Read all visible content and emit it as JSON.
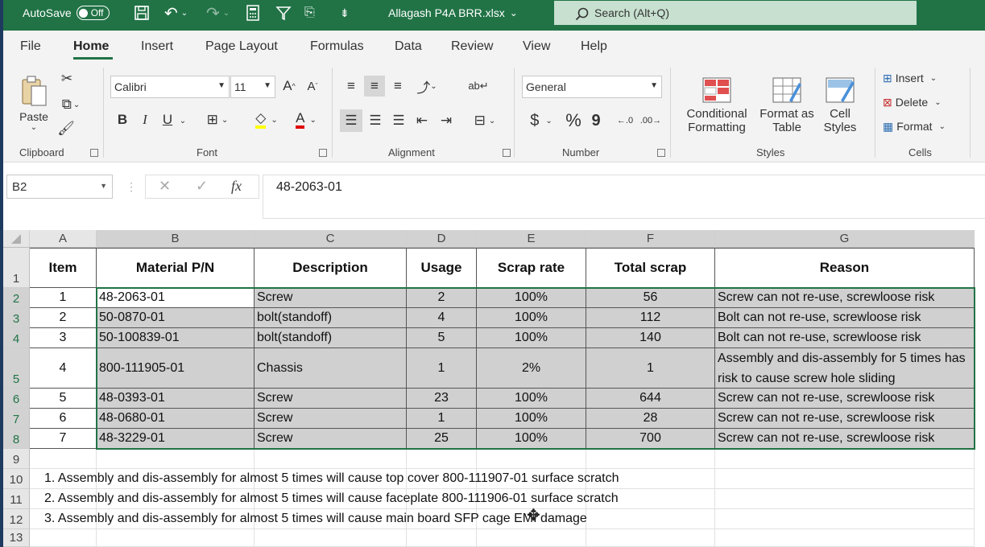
{
  "titlebar": {
    "autosave_label": "AutoSave",
    "autosave_state": "Off",
    "file_name": "Allagash P4A BRR.xlsx",
    "search_placeholder": "Search (Alt+Q)"
  },
  "tabs": [
    "File",
    "Home",
    "Insert",
    "Page Layout",
    "Formulas",
    "Data",
    "Review",
    "View",
    "Help"
  ],
  "active_tab": "Home",
  "ribbon": {
    "clipboard": {
      "paste": "Paste",
      "label": "Clipboard"
    },
    "font": {
      "name": "Calibri",
      "size": "11",
      "label": "Font",
      "bold": "B",
      "italic": "I",
      "underline": "U"
    },
    "alignment": {
      "label": "Alignment"
    },
    "number": {
      "format": "General",
      "label": "Number",
      "currency": "$",
      "percent": "%",
      "comma": "9"
    },
    "styles": {
      "conditional_1": "Conditional",
      "conditional_2": "Formatting",
      "format_table_1": "Format as",
      "format_table_2": "Table",
      "cell_styles_1": "Cell",
      "cell_styles_2": "Styles",
      "label": "Styles"
    },
    "cells": {
      "insert": "Insert",
      "delete": "Delete",
      "format": "Format",
      "label": "Cells"
    }
  },
  "formula_bar": {
    "name_box": "B2",
    "value": "48-2063-01",
    "fx": "fx"
  },
  "columns": [
    "A",
    "B",
    "C",
    "D",
    "E",
    "F",
    "G"
  ],
  "rows": [
    "1",
    "2",
    "3",
    "4",
    "5",
    "6",
    "7",
    "8",
    "9",
    "10",
    "11",
    "12",
    "13"
  ],
  "table": {
    "headers": [
      "Item",
      "Material P/N",
      "Description",
      "Usage",
      "Scrap rate",
      "Total scrap",
      "Reason"
    ],
    "data": [
      [
        "1",
        "48-2063-01",
        "Screw",
        "2",
        "100%",
        "56",
        "Screw can not re-use, screwloose risk"
      ],
      [
        "2",
        "50-0870-01",
        "bolt(standoff)",
        "4",
        "100%",
        "112",
        "Bolt can not re-use, screwloose risk"
      ],
      [
        "3",
        "50-100839-01",
        "bolt(standoff)",
        "5",
        "100%",
        "140",
        "Bolt can not re-use, screwloose risk"
      ],
      [
        "4",
        "800-111905-01",
        "Chassis",
        "1",
        "2%",
        "1",
        "Assembly and dis-assembly for 5 times has risk to cause screw hole sliding"
      ],
      [
        "5",
        "48-0393-01",
        "Screw",
        "23",
        "100%",
        "644",
        "Screw can not re-use, screwloose risk"
      ],
      [
        "6",
        "48-0680-01",
        "Screw",
        "1",
        "100%",
        "28",
        "Screw can not re-use, screwloose risk"
      ],
      [
        "7",
        "48-3229-01",
        "Screw",
        "25",
        "100%",
        "700",
        "Screw can not re-use, screwloose risk"
      ]
    ]
  },
  "notes": [
    "1. Assembly and dis-assembly for almost 5 times will cause top cover 800-111907-01 surface scratch",
    "2. Assembly and dis-assembly for almost 5 times will cause faceplate 800-111906-01 surface scratch",
    "3. Assembly and dis-assembly for almost 5 times will cause main board SFP cage EMI damage"
  ],
  "colors": {
    "brand": "#217346",
    "selection": "#d0d0d0"
  }
}
